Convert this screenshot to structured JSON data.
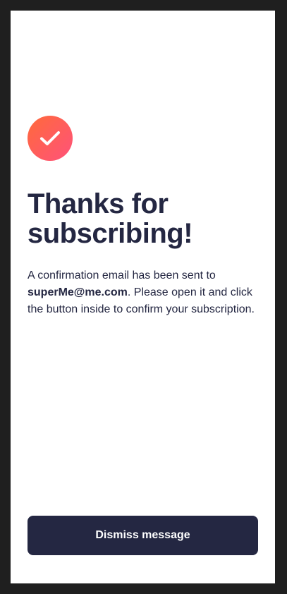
{
  "confirmation": {
    "icon": "success-check-icon",
    "title_line_1": "Thanks for",
    "title_line_2": "subscribing!",
    "message_prefix": "A confirmation email has been sent to",
    "email": "superMe@me.com",
    "message_suffix": ". Please open it and click the button inside to confirm your subscription.",
    "dismiss_label": "Dismiss message"
  },
  "colors": {
    "background": "#1f1f1f",
    "card": "#ffffff",
    "text_primary": "#242742",
    "icon_gradient_start": "#ff6a3a",
    "icon_gradient_end": "#ff527b",
    "button_background": "#242742",
    "button_text": "#ffffff"
  }
}
